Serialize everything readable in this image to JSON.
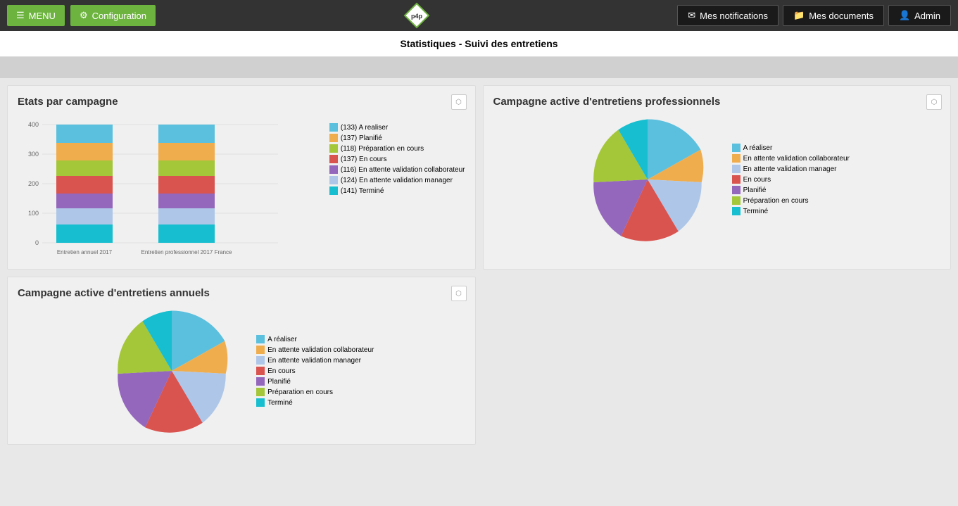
{
  "header": {
    "menu_label": "MENU",
    "config_label": "Configuration",
    "notifications_label": "Mes notifications",
    "documents_label": "Mes documents",
    "admin_label": "Admin",
    "logo_text": "p4p"
  },
  "page": {
    "title": "Statistiques - Suivi des entretiens"
  },
  "panel_etats": {
    "title": "Etats par campagne",
    "legend": [
      {
        "color": "#5bc0de",
        "label": "(133) A realiser"
      },
      {
        "color": "#f0ad4e",
        "label": "(137) Planifié"
      },
      {
        "color": "#a4c639",
        "label": "(118) Préparation en cours"
      },
      {
        "color": "#d9534f",
        "label": "(137) En cours"
      },
      {
        "color": "#9467bd",
        "label": "(116) En attente validation collaborateur"
      },
      {
        "color": "#aec7e8",
        "label": "(124) En attente validation manager"
      },
      {
        "color": "#17becf",
        "label": "(141) Terminé"
      }
    ],
    "bars": [
      {
        "label": "Entretien annuel 2017",
        "segments": [
          {
            "color": "#17becf",
            "pct": 16
          },
          {
            "color": "#aec7e8",
            "pct": 14
          },
          {
            "color": "#9467bd",
            "pct": 13
          },
          {
            "color": "#d9534f",
            "pct": 16
          },
          {
            "color": "#a4c639",
            "pct": 13
          },
          {
            "color": "#f0ad4e",
            "pct": 13
          },
          {
            "color": "#5bc0de",
            "pct": 15
          }
        ]
      },
      {
        "label": "Entretien professionnel 2017 France",
        "segments": [
          {
            "color": "#17becf",
            "pct": 16
          },
          {
            "color": "#aec7e8",
            "pct": 14
          },
          {
            "color": "#9467bd",
            "pct": 13
          },
          {
            "color": "#d9534f",
            "pct": 16
          },
          {
            "color": "#a4c639",
            "pct": 13
          },
          {
            "color": "#f0ad4e",
            "pct": 13
          },
          {
            "color": "#5bc0de",
            "pct": 15
          }
        ]
      }
    ],
    "y_labels": [
      "400",
      "300",
      "200",
      "100",
      "0"
    ]
  },
  "panel_campagne_prof": {
    "title": "Campagne active d'entretiens professionnels",
    "legend": [
      {
        "color": "#5bc0de",
        "label": "A réaliser"
      },
      {
        "color": "#f0ad4e",
        "label": "En attente validation collaborateur"
      },
      {
        "color": "#aec7e8",
        "label": "En attente validation manager"
      },
      {
        "color": "#d9534f",
        "label": "En cours"
      },
      {
        "color": "#9467bd",
        "label": "Planifié"
      },
      {
        "color": "#a4c639",
        "label": "Préparation en cours"
      },
      {
        "color": "#17becf",
        "label": "Terminé"
      }
    ],
    "pie_segments": [
      {
        "color": "#5bc0de",
        "value": 133,
        "startAngle": 0
      },
      {
        "color": "#f0ad4e",
        "value": 116,
        "startAngle": 46
      },
      {
        "color": "#aec7e8",
        "value": 124,
        "startAngle": 86
      },
      {
        "color": "#d9534f",
        "value": 137,
        "startAngle": 129
      },
      {
        "color": "#9467bd",
        "value": 137,
        "startAngle": 177
      },
      {
        "color": "#a4c639",
        "value": 118,
        "startAngle": 225
      },
      {
        "color": "#17becf",
        "value": 141,
        "startAngle": 266
      }
    ]
  },
  "panel_campagne_ann": {
    "title": "Campagne active d'entretiens annuels",
    "legend": [
      {
        "color": "#5bc0de",
        "label": "A réaliser"
      },
      {
        "color": "#f0ad4e",
        "label": "En attente validation collaborateur"
      },
      {
        "color": "#aec7e8",
        "label": "En attente validation manager"
      },
      {
        "color": "#d9534f",
        "label": "En cours"
      },
      {
        "color": "#9467bd",
        "label": "Planifié"
      },
      {
        "color": "#a4c639",
        "label": "Préparation en cours"
      },
      {
        "color": "#17becf",
        "label": "Terminé"
      }
    ]
  }
}
